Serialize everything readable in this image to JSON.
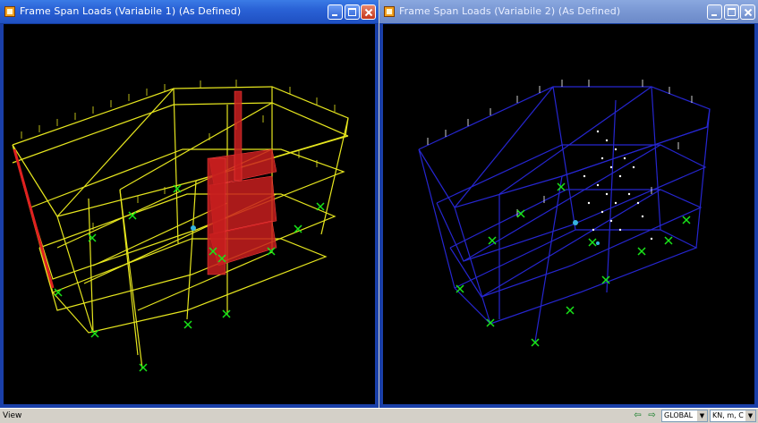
{
  "windows": [
    {
      "title": "Frame Span Loads (Variabile 1) (As Defined)",
      "view_description": "3D frame model with yellow span loads and red area loads on black background"
    },
    {
      "title": "Frame Span Loads (Variabile 2) (As Defined)",
      "view_description": "3D frame model with blue frames and white/cyan span loads on black background"
    }
  ],
  "statusbar": {
    "text": "View",
    "coord_system": "GLOBAL",
    "units": "KN, m, C"
  },
  "icons": {
    "app": "sap2000-app-icon",
    "minimize": "minimize-icon",
    "maximize": "maximize-icon",
    "close": "close-icon",
    "prev": "left-arrow-icon",
    "next": "right-arrow-icon"
  },
  "colors": {
    "frame_left": "#e6e61e",
    "frame_right": "#2a2ad8",
    "load_red": "#d42020",
    "load_white": "#ffffff",
    "support_green": "#19e619",
    "background": "#000000"
  }
}
